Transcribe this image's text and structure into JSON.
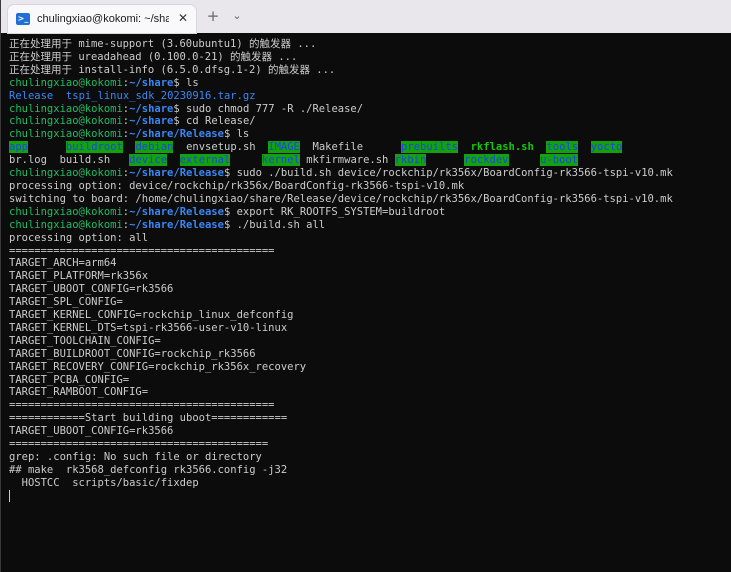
{
  "window": {
    "tab_icon_text": ">_",
    "tab_title": "chulingxiao@kokomi: ~/share",
    "close_glyph": "✕",
    "new_tab_glyph": "+",
    "dropdown_glyph": "⌄"
  },
  "colors": {
    "background": "#0c0c0c",
    "text": "#cccccc",
    "prompt_user": "#21bb64",
    "prompt_path": "#3a87f5",
    "dir_highlight_bg": "#13a10e",
    "dir_highlight_fg": "#1b46e6",
    "executable": "#16c60c"
  },
  "terminal": {
    "lines": [
      {
        "kind": "text",
        "text": "正在处理用于 mime-support (3.60ubuntu1) 的触发器 ..."
      },
      {
        "kind": "text",
        "text": "正在处理用于 ureadahead (0.100.0-21) 的触发器 ..."
      },
      {
        "kind": "text",
        "text": "正在处理用于 install-info (6.5.0.dfsg.1-2) 的触发器 ..."
      },
      {
        "kind": "prompt",
        "user": "chulingxiao@kokomi",
        "path": "~/share",
        "cmd": "ls"
      },
      {
        "kind": "ls",
        "items": [
          {
            "text": "Release",
            "type": "dir"
          },
          {
            "text": "  "
          },
          {
            "text": "tspi_linux_sdk_20230916.tar.gz",
            "type": "archive"
          }
        ]
      },
      {
        "kind": "prompt",
        "user": "chulingxiao@kokomi",
        "path": "~/share",
        "cmd": "sudo chmod 777 -R ./Release/"
      },
      {
        "kind": "prompt",
        "user": "chulingxiao@kokomi",
        "path": "~/share",
        "cmd": "cd Release/"
      },
      {
        "kind": "prompt",
        "user": "chulingxiao@kokomi",
        "path": "~/share/Release",
        "cmd": "ls"
      },
      {
        "kind": "ls",
        "items": [
          {
            "text": "app",
            "type": "dirhl"
          },
          {
            "text": "      "
          },
          {
            "text": "buildroot",
            "type": "dirhl"
          },
          {
            "text": "  "
          },
          {
            "text": "debian",
            "type": "dirhl"
          },
          {
            "text": "  "
          },
          {
            "text": "envsetup.sh",
            "type": "file"
          },
          {
            "text": "  "
          },
          {
            "text": "IMAGE",
            "type": "dirhl"
          },
          {
            "text": "  "
          },
          {
            "text": "Makefile",
            "type": "file"
          },
          {
            "text": "      "
          },
          {
            "text": "prebuilts",
            "type": "dirhl"
          },
          {
            "text": "  "
          },
          {
            "text": "rkflash.sh",
            "type": "exe"
          },
          {
            "text": "  "
          },
          {
            "text": "tools",
            "type": "dirhl"
          },
          {
            "text": "  "
          },
          {
            "text": "yocto",
            "type": "dirhl"
          }
        ]
      },
      {
        "kind": "ls",
        "items": [
          {
            "text": "br.log",
            "type": "file"
          },
          {
            "text": "  "
          },
          {
            "text": "build.sh",
            "type": "file"
          },
          {
            "text": "   "
          },
          {
            "text": "device",
            "type": "dirhl"
          },
          {
            "text": "  "
          },
          {
            "text": "external",
            "type": "dirhl"
          },
          {
            "text": "     "
          },
          {
            "text": "kernel",
            "type": "dirhl"
          },
          {
            "text": " "
          },
          {
            "text": "mkfirmware.sh",
            "type": "file"
          },
          {
            "text": " "
          },
          {
            "text": "rkbin",
            "type": "dirhl"
          },
          {
            "text": "      "
          },
          {
            "text": "rockdev",
            "type": "dirhl"
          },
          {
            "text": "     "
          },
          {
            "text": "u-boot",
            "type": "dirhl"
          }
        ]
      },
      {
        "kind": "prompt",
        "user": "chulingxiao@kokomi",
        "path": "~/share/Release",
        "cmd": "sudo ./build.sh device/rockchip/rk356x/BoardConfig-rk3566-tspi-v10.mk"
      },
      {
        "kind": "text",
        "text": "processing option: device/rockchip/rk356x/BoardConfig-rk3566-tspi-v10.mk"
      },
      {
        "kind": "text",
        "text": "switching to board: /home/chulingxiao/share/Release/device/rockchip/rk356x/BoardConfig-rk3566-tspi-v10.mk"
      },
      {
        "kind": "prompt",
        "user": "chulingxiao@kokomi",
        "path": "~/share/Release",
        "cmd": "export RK_ROOTFS_SYSTEM=buildroot"
      },
      {
        "kind": "prompt",
        "user": "chulingxiao@kokomi",
        "path": "~/share/Release",
        "cmd": "./build.sh all"
      },
      {
        "kind": "text",
        "text": "processing option: all"
      },
      {
        "kind": "text",
        "text": "=========================================="
      },
      {
        "kind": "text",
        "text": "TARGET_ARCH=arm64"
      },
      {
        "kind": "text",
        "text": "TARGET_PLATFORM=rk356x"
      },
      {
        "kind": "text",
        "text": "TARGET_UBOOT_CONFIG=rk3566"
      },
      {
        "kind": "text",
        "text": "TARGET_SPL_CONFIG="
      },
      {
        "kind": "text",
        "text": "TARGET_KERNEL_CONFIG=rockchip_linux_defconfig"
      },
      {
        "kind": "text",
        "text": "TARGET_KERNEL_DTS=tspi-rk3566-user-v10-linux"
      },
      {
        "kind": "text",
        "text": "TARGET_TOOLCHAIN_CONFIG="
      },
      {
        "kind": "text",
        "text": "TARGET_BUILDROOT_CONFIG=rockchip_rk3566"
      },
      {
        "kind": "text",
        "text": "TARGET_RECOVERY_CONFIG=rockchip_rk356x_recovery"
      },
      {
        "kind": "text",
        "text": "TARGET_PCBA_CONFIG="
      },
      {
        "kind": "text",
        "text": "TARGET_RAMBOOT_CONFIG="
      },
      {
        "kind": "text",
        "text": "=========================================="
      },
      {
        "kind": "text",
        "text": "============Start building uboot============"
      },
      {
        "kind": "text",
        "text": "TARGET_UBOOT_CONFIG=rk3566"
      },
      {
        "kind": "text",
        "text": "========================================="
      },
      {
        "kind": "text",
        "text": "grep: .config: No such file or directory"
      },
      {
        "kind": "text",
        "text": "## make  rk3568_defconfig rk3566.config -j32"
      },
      {
        "kind": "text",
        "text": "  HOSTCC  scripts/basic/fixdep"
      },
      {
        "kind": "cursor"
      }
    ]
  }
}
